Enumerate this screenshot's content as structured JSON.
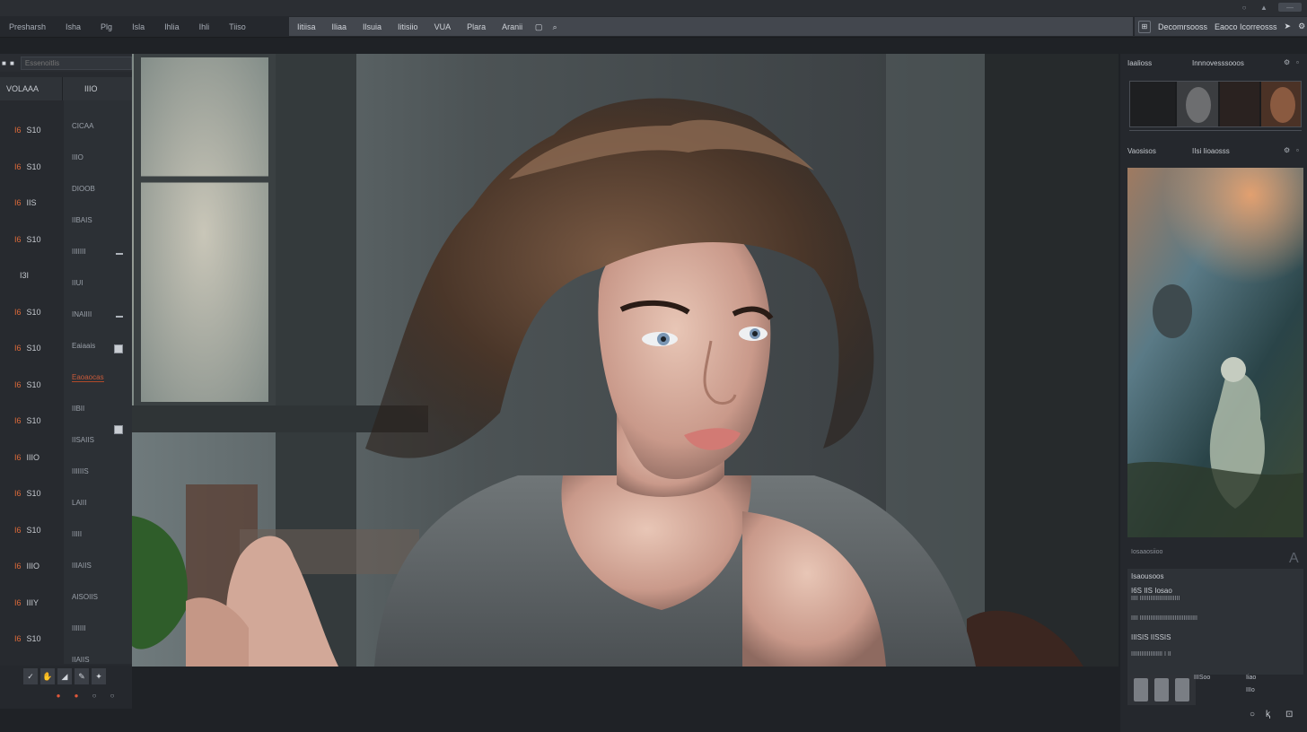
{
  "titlebar": {
    "buttons": [
      "○",
      "▲",
      "—"
    ]
  },
  "menu": {
    "left": [
      "Presharsh",
      "Isha",
      "Plg",
      "Isla",
      "Ihlia",
      "Ihli",
      "Tiiso"
    ],
    "mid": [
      "Iitiisa",
      "Iliaa",
      "Ilsuia",
      "Iitisiio",
      "VUA",
      "Plara",
      "Aranii"
    ],
    "right": [
      "Decomrsooss",
      "Eaoco Icorreosss"
    ]
  },
  "left_panel": {
    "search_placeholder": "Essenoitlis",
    "dots": "■ ■",
    "head_left": "VOLAAA",
    "head_right": "IIIO",
    "col1": [
      "S10",
      "S10",
      "IIS",
      "S10",
      "I3I",
      "S10",
      "S10",
      "S10",
      "S10",
      "IIIO",
      "S10",
      "S10",
      "IIIO",
      "IIIY",
      "S10"
    ],
    "col1_acc": [
      "I6",
      "I6",
      "I6",
      "I6",
      "",
      "I6",
      "I6",
      "I6",
      "I6",
      "I6",
      "I6",
      "I6",
      "I6",
      "I6",
      "I6"
    ],
    "col2": [
      "CICAA",
      "IIIO",
      "DIOOB",
      "IIBAIS",
      "IIIIIII",
      "IIUI",
      "INAIIII",
      "Eaiaais",
      "Eaoaocas",
      "IIBII",
      "IISAIIS",
      "IIIIIIS",
      "LAIII",
      "IIIII",
      "IIIAIIS",
      "AISOIIS",
      "IIIIIII",
      "IIAIIS"
    ]
  },
  "left_tools": {
    "buttons": [
      "✓",
      "✋",
      "◢",
      "✎",
      "✦"
    ],
    "circles": [
      "●",
      "●",
      "○",
      "○"
    ]
  },
  "right_panel": {
    "head1": {
      "t1": "Iaalioss",
      "t2": "Innnovesssooos"
    },
    "head2": {
      "t1": "Vaosisos",
      "t2": "IIsi Iioaosss"
    },
    "info": {
      "title": "Isaousoos",
      "line1": "I6S IIS Iosao",
      "line2": "IIII IIIIIIIIIIIIIIIIIIIIIII",
      "line3": "IIII IIIIIIIIIIIIIIIIIIIIIIIIIIIIIIIII",
      "line4": "IIISIS IISSIS",
      "line5": "IIIIIIIIIIIIIIIIII I II",
      "caption": "Iosaaosiioo",
      "big": "A"
    },
    "footer": {
      "a": "Iiao",
      "b": "IIIo",
      "c": "IIISoo"
    }
  }
}
